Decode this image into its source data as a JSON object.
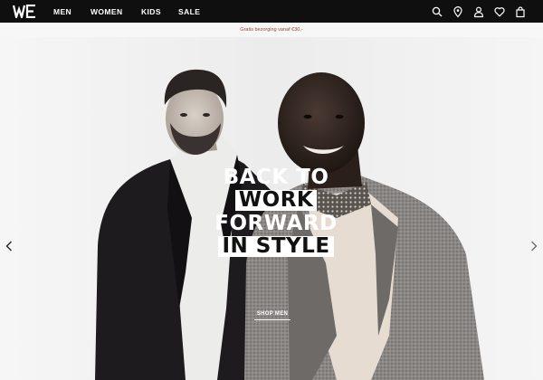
{
  "brand": {
    "logo_icon": "we-logo-icon"
  },
  "nav": {
    "items": [
      {
        "label": "MEN"
      },
      {
        "label": "WOMEN"
      },
      {
        "label": "KIDS"
      },
      {
        "label": "SALE"
      }
    ]
  },
  "header_icons": [
    "search-icon",
    "location-pin-icon",
    "account-icon",
    "wishlist-heart-icon",
    "shopping-bag-icon"
  ],
  "promo": {
    "text": "Gratis bezorging vanaf €30,-"
  },
  "hero": {
    "headline": [
      "BACK TO",
      "WORK",
      "FORWARD",
      "IN STYLE"
    ],
    "cta_label": "SHOP MEN",
    "prev_icon": "chevron-left-icon",
    "next_icon": "chevron-right-icon"
  },
  "colors": {
    "header_bg": "#0f0f0f",
    "promo_text": "#8a4a3a",
    "hero_bg": "#f3f3f3"
  }
}
